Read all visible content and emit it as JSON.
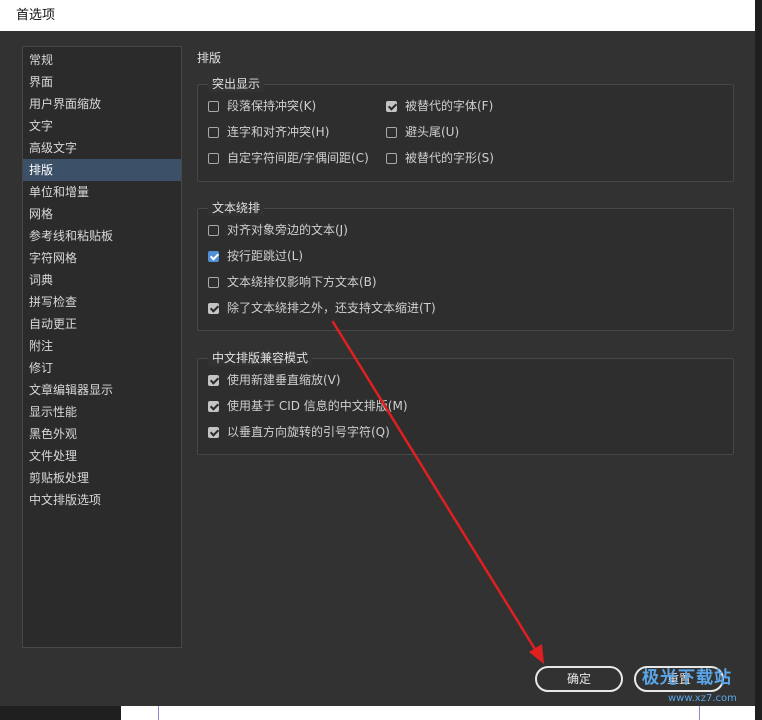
{
  "window": {
    "title": "首选项"
  },
  "sidebar": {
    "items": [
      {
        "label": "常规"
      },
      {
        "label": "界面"
      },
      {
        "label": "用户界面缩放"
      },
      {
        "label": "文字"
      },
      {
        "label": "高级文字"
      },
      {
        "label": "排版",
        "selected": true
      },
      {
        "label": "单位和增量"
      },
      {
        "label": "网格"
      },
      {
        "label": "参考线和粘贴板"
      },
      {
        "label": "字符网格"
      },
      {
        "label": "词典"
      },
      {
        "label": "拼写检查"
      },
      {
        "label": "自动更正"
      },
      {
        "label": "附注"
      },
      {
        "label": "修订"
      },
      {
        "label": "文章编辑器显示"
      },
      {
        "label": "显示性能"
      },
      {
        "label": "黑色外观"
      },
      {
        "label": "文件处理"
      },
      {
        "label": "剪贴板处理"
      },
      {
        "label": "中文排版选项"
      }
    ]
  },
  "main": {
    "section_title": "排版",
    "highlight": {
      "title": "突出显示",
      "options": [
        {
          "label": "段落保持冲突(K)",
          "checked": false
        },
        {
          "label": "被替代的字体(F)",
          "checked": true
        },
        {
          "label": "连字和对齐冲突(H)",
          "checked": false
        },
        {
          "label": "避头尾(U)",
          "checked": false
        },
        {
          "label": "自定字符间距/字偶间距(C)",
          "checked": false
        },
        {
          "label": "被替代的字形(S)",
          "checked": false
        }
      ]
    },
    "text_wrap": {
      "title": "文本绕排",
      "options": [
        {
          "label": "对齐对象旁边的文本(J)",
          "checked": false
        },
        {
          "label": "按行距跳过(L)",
          "checked": true
        },
        {
          "label": "文本绕排仅影响下方文本(B)",
          "checked": false
        },
        {
          "label": "除了文本绕排之外，还支持文本缩进(T)",
          "checked": true
        }
      ]
    },
    "cjk_compat": {
      "title": "中文排版兼容模式",
      "options": [
        {
          "label": "使用新建垂直缩放(V)",
          "checked": true
        },
        {
          "label": "使用基于 CID 信息的中文排版(M)",
          "checked": true
        },
        {
          "label": "以垂直方向旋转的引号字符(Q)",
          "checked": true
        }
      ]
    }
  },
  "buttons": {
    "ok": "确定",
    "reset": "重置"
  },
  "watermark": {
    "text": "极光下载站",
    "url": "www.xz7.com"
  },
  "colors": {
    "selected_item": "#3c5067",
    "checkbox_primary": "#4e8fd8",
    "annotation_arrow": "#e02020"
  }
}
